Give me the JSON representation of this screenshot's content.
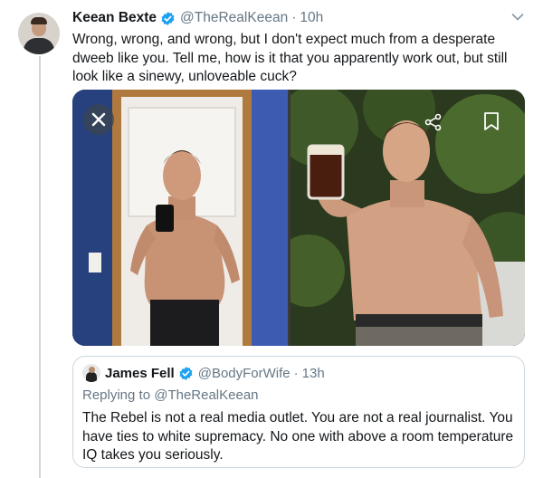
{
  "tweet": {
    "author_name": "Keean Bexte",
    "author_handle": "@TheRealKeean",
    "separator": "·",
    "time": "10h",
    "text": "Wrong, wrong, and wrong, but I don't expect much from a desperate dweeb like you. Tell me, how is it that you apparently work out, but still look like a sinewy, unloveable cuck?",
    "verified": true
  },
  "quoted_tweet": {
    "author_name": "James Fell",
    "author_handle": "@BodyForWife",
    "separator": "·",
    "time": "13h",
    "replying_prefix": "Replying to",
    "replying_to": "@TheRealKeean",
    "text": "The Rebel is not a real media outlet. You are not a real journalist. You have ties to white supremacy. No one with above a room temperature IQ takes you seriously.",
    "verified": true
  },
  "media": {
    "photos": [
      "mirror-selfie-photo",
      "beer-toast-photo"
    ],
    "overlay_icons": [
      "close-icon",
      "share-icon",
      "bookmark-icon"
    ]
  },
  "colors": {
    "verified_blue": "#1da1f2",
    "secondary_text": "#657786",
    "border": "#ccd6dd"
  }
}
